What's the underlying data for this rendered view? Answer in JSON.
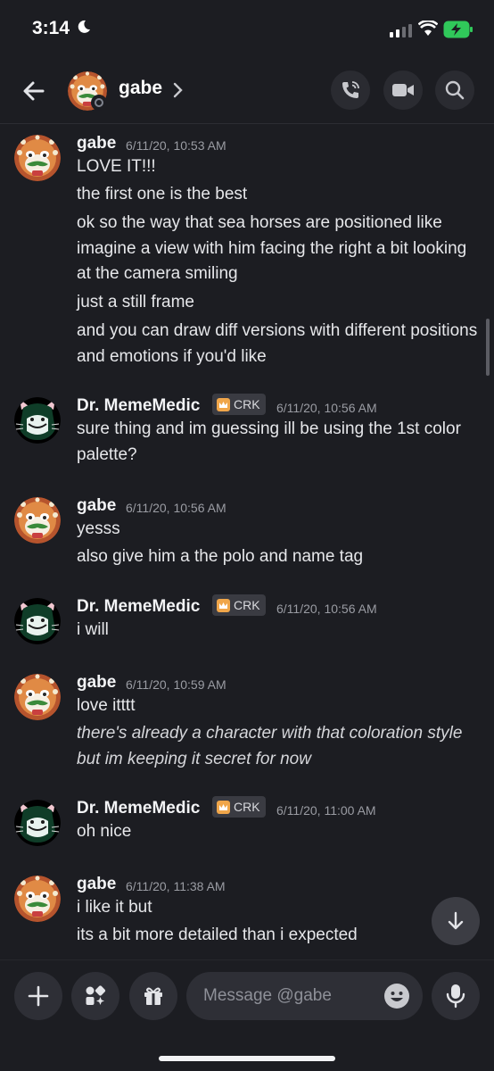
{
  "status_bar": {
    "time": "3:14"
  },
  "header": {
    "name": "gabe"
  },
  "messages": [
    {
      "author": "gabe",
      "timestamp": "6/11/20, 10:53 AM",
      "lines": [
        "LOVE IT!!!",
        "the first one is the best",
        "ok so the way that sea horses are positioned like imagine a view with him facing the right a bit looking at the camera smiling",
        "just a still frame",
        "and you can draw diff versions with different positions and emotions if you'd like"
      ]
    },
    {
      "author": "Dr. MemeMedic",
      "badge": "CRK",
      "timestamp": "6/11/20, 10:56 AM",
      "lines": [
        "sure thing and im guessing ill be using the 1st color palette?"
      ]
    },
    {
      "author": "gabe",
      "timestamp": "6/11/20, 10:56 AM",
      "lines": [
        "yesss",
        "also give him a the polo and name tag"
      ]
    },
    {
      "author": "Dr. MemeMedic",
      "badge": "CRK",
      "timestamp": "6/11/20, 10:56 AM",
      "lines": [
        "i will"
      ]
    },
    {
      "author": "gabe",
      "timestamp": "6/11/20, 10:59 AM",
      "lines": [
        "love itttt",
        "there's already a character with that coloration style but im keeping it secret for now"
      ]
    },
    {
      "author": "Dr. MemeMedic",
      "badge": "CRK",
      "timestamp": "6/11/20, 11:00 AM",
      "lines": [
        "oh nice"
      ]
    },
    {
      "author": "gabe",
      "timestamp": "6/11/20, 11:38 AM",
      "lines": [
        "i like it but",
        "its a bit more detailed than i expected"
      ]
    }
  ],
  "composer": {
    "placeholder": "Message @gabe"
  },
  "colors": {
    "background": "#1c1d22",
    "panel": "#2e2f36",
    "text": "#e6e7ea",
    "timestamp": "#9a9ca3"
  }
}
